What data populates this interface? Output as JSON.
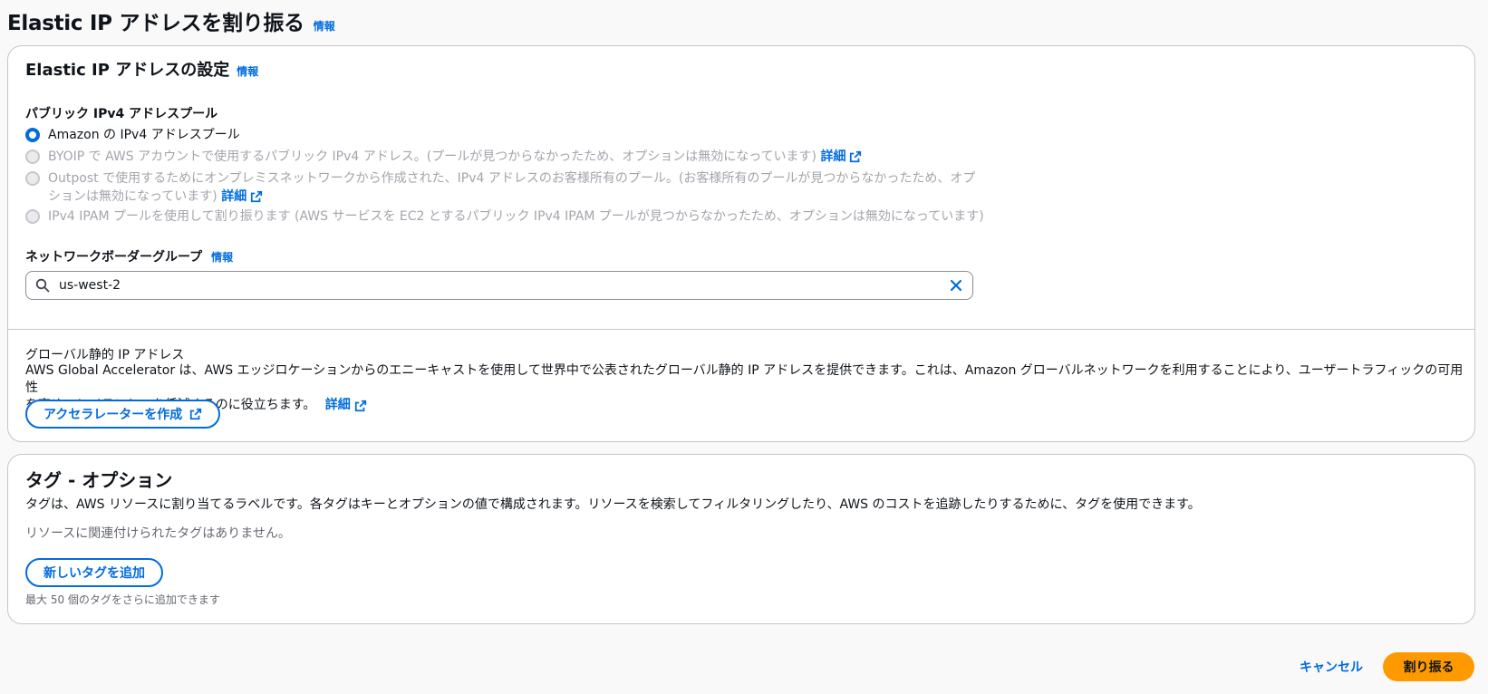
{
  "page": {
    "title": "Elastic IP アドレスを割り振る",
    "info": "情報"
  },
  "eip_settings": {
    "heading": "Elastic IP アドレスの設定",
    "info": "情報",
    "pool_label": "パブリック IPv4 アドレスプール",
    "options": [
      {
        "label": "Amazon の IPv4 アドレスプール",
        "selected": true,
        "disabled": false
      },
      {
        "label": "BYOIP で AWS アカウントで使用するパブリック IPv4 アドレス。(プールが見つからなかったため、オプションは無効になっています)",
        "link": "詳細",
        "selected": false,
        "disabled": true
      },
      {
        "label_line1": "Outpost で使用するためにオンプレミスネットワークから作成された、IPv4 アドレスのお客様所有のプール。(お客様所有のプールが見つからなかったため、オプ",
        "label_line2": "ションは無効になっています)",
        "link": "詳細",
        "selected": false,
        "disabled": true
      },
      {
        "label": "IPv4 IPAM プールを使用して割り振ります (AWS サービスを EC2 とするパブリック IPv4 IPAM プールが見つからなかったため、オプションは無効になっています)",
        "selected": false,
        "disabled": true
      }
    ],
    "nbg_label": "ネットワークボーダーグループ",
    "nbg_info": "情報",
    "nbg_value": "us-west-2"
  },
  "global_static_ip": {
    "title": "グローバル静的 IP アドレス",
    "description_line1": "AWS Global Accelerator は、AWS エッジロケーションからのエニーキャストを使用して世界中で公表されたグローバル静的 IP アドレスを提供できます。これは、Amazon グローバルネットワークを利用することにより、ユーザートラフィックの可用性",
    "description_line2": "を高め、レイテンシーを低減するのに役立ちます。",
    "link": "詳細",
    "button": "アクセラレーターを作成"
  },
  "tags": {
    "heading": "タグ - オプション",
    "description": "タグは、AWS リソースに割り当てるラベルです。各タグはキーとオプションの値で構成されます。リソースを検索してフィルタリングしたり、AWS のコストを追跡したりするために、タグを使用できます。",
    "empty": "リソースに関連付けられたタグはありません。",
    "add_button": "新しいタグを追加",
    "hint": "最大 50 個のタグをさらに追加できます"
  },
  "footer": {
    "cancel": "キャンセル",
    "submit": "割り振る"
  },
  "colors": {
    "link": "#006ce0",
    "primary": "#ff9900",
    "border": "#c6c6cd",
    "disabled_text": "#a4a4ad"
  }
}
